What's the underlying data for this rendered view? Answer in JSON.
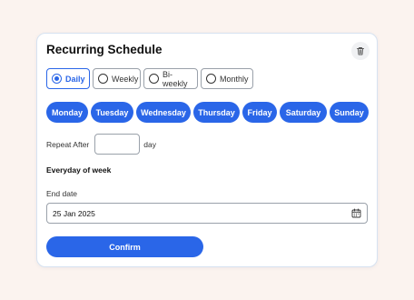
{
  "title": "Recurring Schedule",
  "frequency": {
    "options": [
      "Daily",
      "Weekly",
      "Bi-weekly",
      "Monthly"
    ],
    "selected": "Daily"
  },
  "days": [
    "Monday",
    "Tuesday",
    "Wednesday",
    "Thursday",
    "Friday",
    "Saturday",
    "Sunday"
  ],
  "repeat": {
    "label": "Repeat After",
    "value": "",
    "unit": "day"
  },
  "summary": "Everyday of week",
  "end_date": {
    "label": "End date",
    "value": "25 Jan 2025"
  },
  "confirm_label": "Confirm",
  "colors": {
    "accent": "#2a66e8",
    "background": "#fbf3ef",
    "card_border": "#d6e2f1"
  },
  "icons": {
    "delete": "trash-icon",
    "calendar": "calendar-icon"
  }
}
